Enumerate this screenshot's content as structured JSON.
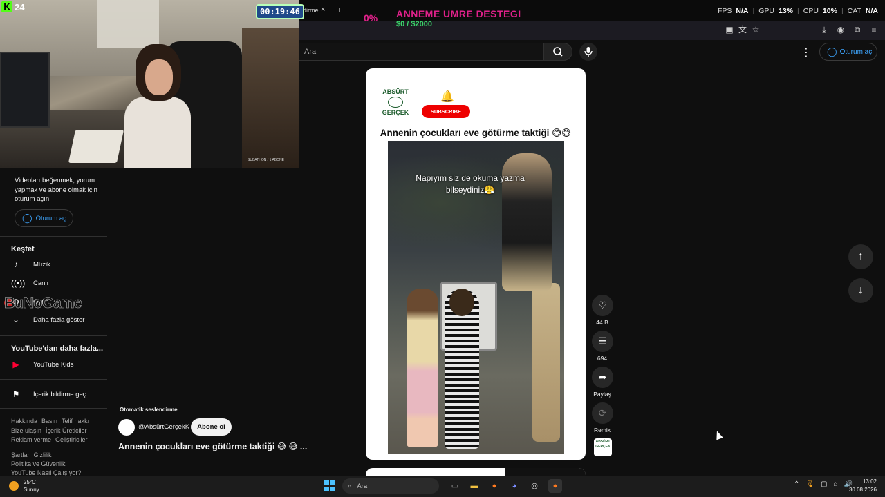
{
  "overlay": {
    "viewer_count": "24",
    "timer": "00:19:46",
    "goal_percent": "0%",
    "goal_title": "ANNEME UMRE DESTEGI",
    "goal_amount": "$0 / $2000",
    "subathon_text": "SUBATHON / 1 ABONE",
    "stats": {
      "fps_label": "FPS",
      "fps_value": "N/A",
      "gpu_label": "GPU",
      "gpu_value": "13%",
      "cpu_label": "CPU",
      "cpu_value": "10%",
      "cat_label": "CAT",
      "cat_value": "N/A"
    },
    "kick_color": "#53fc18",
    "goal_color": "#e0218a"
  },
  "browser": {
    "tab_title": "endirmei",
    "tab_close": "×",
    "new_tab": "+"
  },
  "header": {
    "search_placeholder": "Ara",
    "signin_label": "Oturum aç"
  },
  "sidebar": {
    "signin_message": "Videoları beğenmek, yorum yapmak ve abone olmak için oturum açın.",
    "signin_button": "Oturum aç",
    "explore_heading": "Keşfet",
    "explore_items": [
      {
        "label": "Müzik",
        "icon": "music-note-icon"
      },
      {
        "label": "Canlı",
        "icon": "live-icon"
      },
      {
        "label": "Oyun",
        "icon": "gamepad-icon"
      },
      {
        "label": "Daha fazla göster",
        "icon": "chevron-down-icon"
      }
    ],
    "more_heading": "YouTube'dan daha fazla...",
    "more_items": [
      {
        "label": "YouTube Kids",
        "icon": "youtube-kids-icon"
      }
    ],
    "report_item": {
      "label": "İçerik bildirme geç...",
      "icon": "flag-icon"
    },
    "footer": {
      "line1": [
        "Hakkında",
        "Basın",
        "Telif hakkı"
      ],
      "line2": [
        "Bize ulaşın",
        "İçerik Üreticiler"
      ],
      "line3": [
        "Reklam verme",
        "Geliştiriciler"
      ],
      "line4": [
        "Şartlar",
        "Gizlilik"
      ],
      "line5": [
        "Politika ve Güvenlik"
      ],
      "line6": [
        "YouTube Nasıl Çalışıyor?"
      ]
    },
    "watermark": "BuNoGame"
  },
  "short": {
    "channel_logo_top": "ABSÜRT",
    "channel_logo_bottom": "GERÇEK",
    "subscribe_badge": "SUBSCRIBE",
    "title": "Annenin çocukları eve götürme taktiği 😅😅",
    "caption": "Napıyım siz de okuma yazma bilseydiniz😤",
    "likes": "44 B",
    "comments": "694",
    "share_label": "Paylaş",
    "remix_label": "Remix"
  },
  "meta": {
    "auto_dub": "Otomatik seslendirme",
    "handle": "@AbsürtGerçekK",
    "subscribe": "Abone ol",
    "title": "Annenin çocukları eve götürme taktiği 😅 😅 ..."
  },
  "taskbar": {
    "weather_temp": "25°C",
    "weather_cond": "Sunny",
    "search_label": "Ara",
    "time": "13:02",
    "date": "30.08.2026"
  }
}
